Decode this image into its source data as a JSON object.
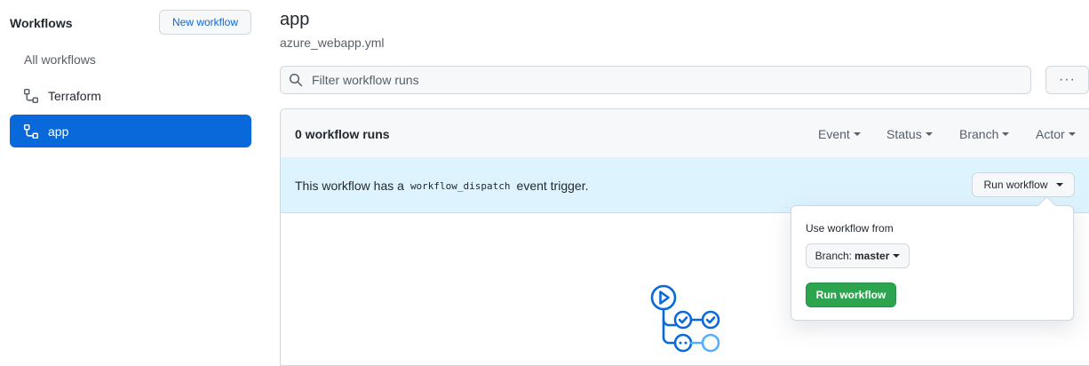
{
  "sidebar": {
    "title": "Workflows",
    "new_button": "New workflow",
    "items": [
      {
        "label": "All workflows"
      },
      {
        "label": "Terraform",
        "icon": "workflow-icon"
      },
      {
        "label": "app",
        "icon": "workflow-icon",
        "selected": true
      }
    ]
  },
  "main": {
    "title": "app",
    "filename": "azure_webapp.yml",
    "filter_placeholder": "Filter workflow runs",
    "more_label": "···",
    "runs_count": "0 workflow runs",
    "filters": [
      "Event",
      "Status",
      "Branch",
      "Actor"
    ],
    "dispatch": {
      "text_before": "This workflow has a",
      "code": "workflow_dispatch",
      "text_after": "event trigger.",
      "button": "Run workflow"
    },
    "popover": {
      "label": "Use workflow from",
      "branch_prefix": "Branch:",
      "branch_value": "master",
      "run_button": "Run workflow"
    }
  },
  "colors": {
    "accent": "#0969da",
    "success": "#2da44e",
    "info_bg": "#ddf4ff"
  }
}
